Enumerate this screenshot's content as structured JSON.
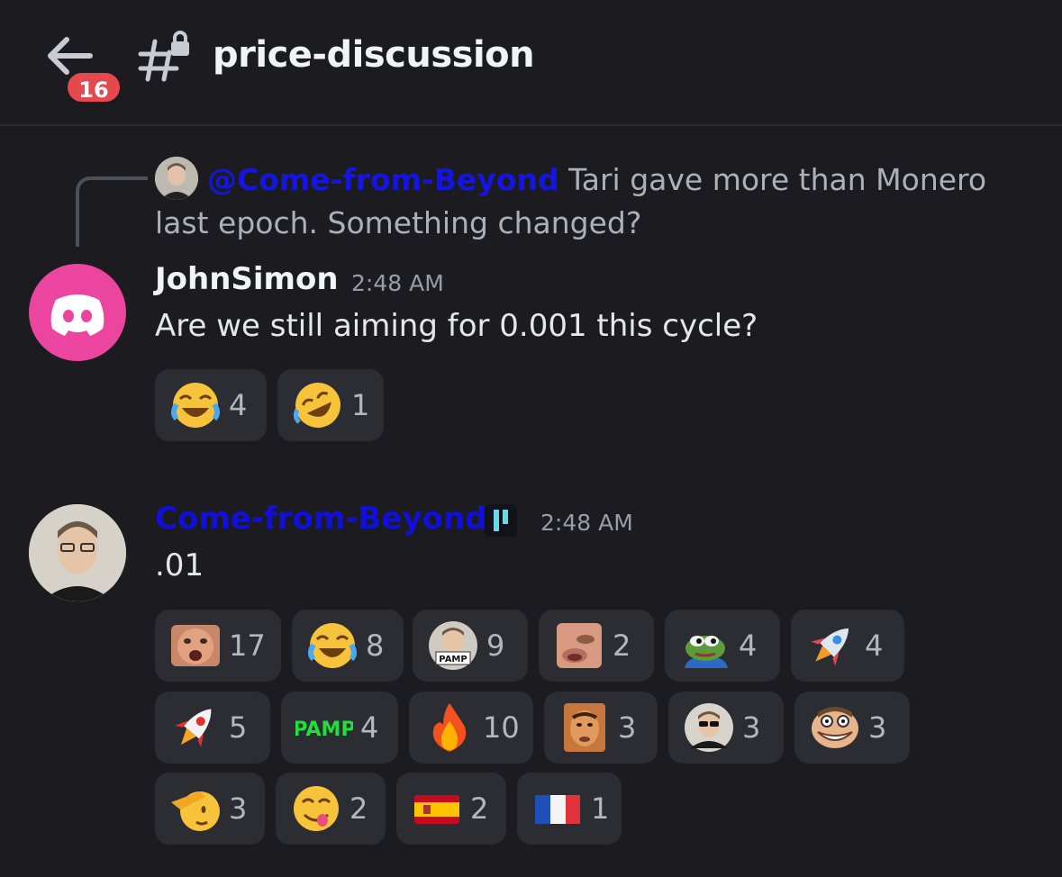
{
  "header": {
    "badge_count": "16",
    "channel_name": "price-discussion"
  },
  "reply": {
    "mention": "@Come-from-Beyond",
    "text": " Tari gave more than Monero last epoch. Something changed?"
  },
  "messages": [
    {
      "author": "JohnSimon",
      "time": "2:48 AM",
      "text": "Are we still aiming for 0.001 this cycle?",
      "reactions": [
        {
          "icon": "joy-emoji-icon",
          "count": "4"
        },
        {
          "icon": "rofl-emoji-icon",
          "count": "1"
        }
      ]
    },
    {
      "author": "Come-from-Beyond",
      "time": "2:48 AM",
      "text": ".01",
      "reactions": [
        {
          "icon": "face-custom-emoji-icon",
          "count": "17"
        },
        {
          "icon": "joy-emoji-icon",
          "count": "8"
        },
        {
          "icon": "pamp-avatar-emoji-icon",
          "count": "9",
          "label": "PAMP"
        },
        {
          "icon": "face-closeup-emoji-icon",
          "count": "2"
        },
        {
          "icon": "pepe-emoji-icon",
          "count": "4"
        },
        {
          "icon": "rocket-emoji-icon",
          "count": "4"
        },
        {
          "icon": "rocket-red-emoji-icon",
          "count": "5"
        },
        {
          "icon": "pamp-text-emoji-icon",
          "count": "4",
          "label": "PAMP"
        },
        {
          "icon": "fire-emoji-icon",
          "count": "10"
        },
        {
          "icon": "face-orange-emoji-icon",
          "count": "3"
        },
        {
          "icon": "sunglasses-avatar-emoji-icon",
          "count": "3"
        },
        {
          "icon": "troll-face-emoji-icon",
          "count": "3"
        },
        {
          "icon": "salute-emoji-icon",
          "count": "3"
        },
        {
          "icon": "yum-emoji-icon",
          "count": "2"
        },
        {
          "icon": "spain-flag-icon",
          "count": "2"
        },
        {
          "icon": "france-flag-icon",
          "count": "1"
        }
      ]
    }
  ],
  "colors": {
    "background": "#1c1c20",
    "reaction_bg": "#2b2d33",
    "badge": "#e5484d",
    "discord_pink": "#eb459f",
    "mention_blue": "#1515e0"
  }
}
